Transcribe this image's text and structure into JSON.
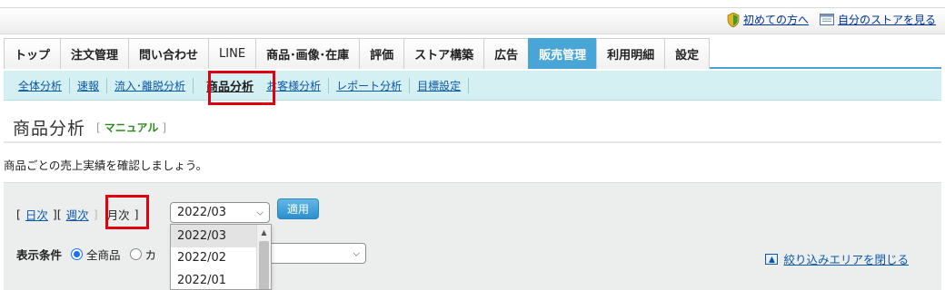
{
  "header": {
    "links": [
      {
        "label": "初めての方へ",
        "icon": "shield-icon"
      },
      {
        "label": "自分のストアを見る",
        "icon": "monitor-icon"
      }
    ]
  },
  "tabs": [
    {
      "label": "トップ"
    },
    {
      "label": "注文管理"
    },
    {
      "label": "問い合わせ"
    },
    {
      "label": "LINE"
    },
    {
      "label": "商品･画像･在庫"
    },
    {
      "label": "評価"
    },
    {
      "label": "ストア構築"
    },
    {
      "label": "広告"
    },
    {
      "label": "販売管理"
    },
    {
      "label": "利用明細"
    },
    {
      "label": "設定"
    }
  ],
  "active_tab": "販売管理",
  "subnav": [
    {
      "label": "全体分析"
    },
    {
      "label": "速報"
    },
    {
      "label": "流入･離脱分析"
    },
    {
      "label": "商品分析"
    },
    {
      "label": "お客様分析"
    },
    {
      "label": "レポート分析"
    },
    {
      "label": "目標設定"
    }
  ],
  "page": {
    "title": "商品分析",
    "manual_open": "[",
    "manual_label": "マニュアル",
    "manual_close": "]",
    "description": "商品ごとの売上実績を確認しましょう。"
  },
  "filter": {
    "bracket_open": "[",
    "bracket_mid": "][",
    "bracket_close": "]",
    "daily": "日次",
    "weekly": "週次",
    "monthly": "月次",
    "month_value": "2022/03",
    "apply": "適用",
    "condition_label": "表示条件",
    "radio_all": "全商品",
    "radio_other": "カ",
    "close_area": "絞り込みエリアを閉じる",
    "month_options": [
      "2022/03",
      "2022/02",
      "2022/01"
    ]
  },
  "colors": {
    "tab_active": "#49a5d6",
    "subnav_bg": "#d4f0f3",
    "highlight": "#e0000f",
    "link": "#0b58a8",
    "manual": "#2c8a1c"
  }
}
